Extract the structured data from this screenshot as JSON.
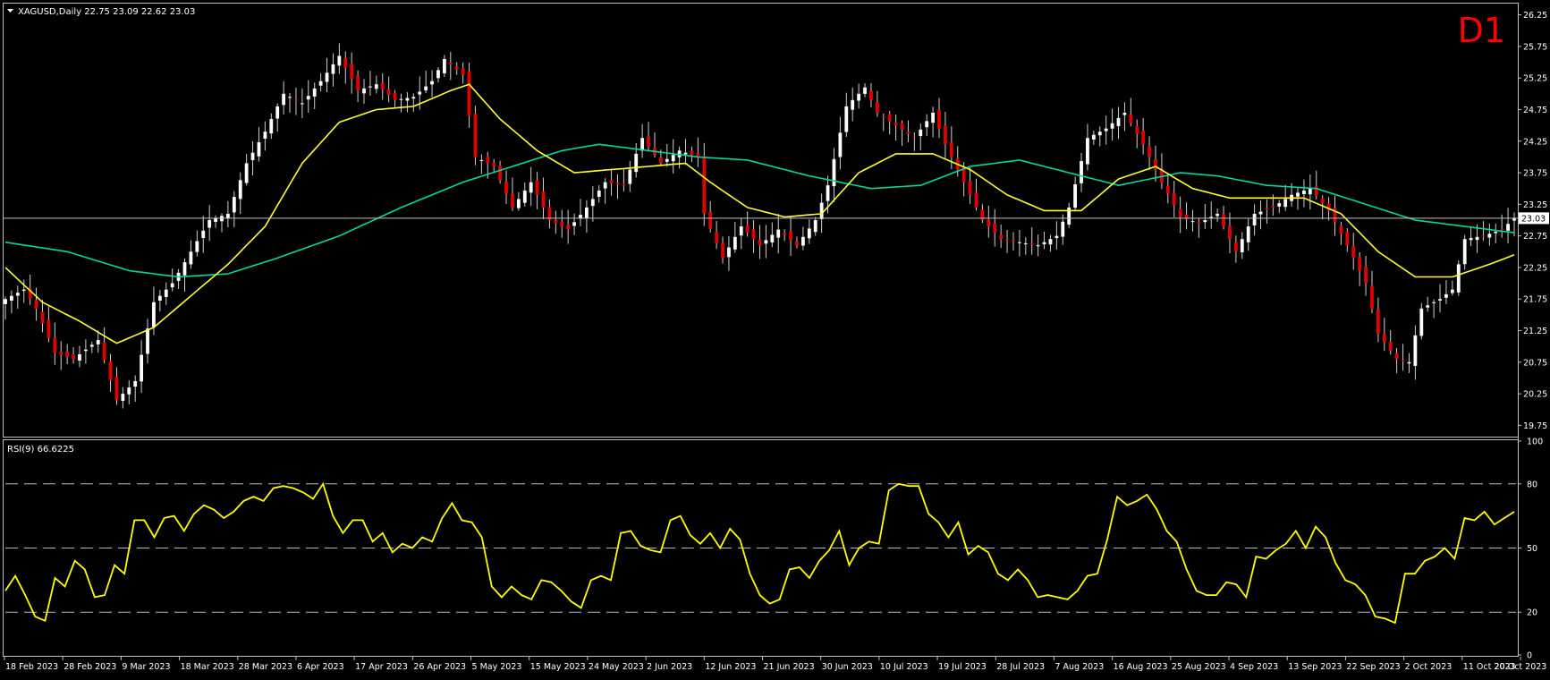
{
  "header": {
    "symbol_label": "XAGUSD,Daily  22.75 23.09 22.62 23.03",
    "timeframe_badge": "D1",
    "current_price_label": "23.03"
  },
  "rsi_panel": {
    "label": "RSI(9) 66.6225",
    "ticks": [
      "100",
      "80",
      "50",
      "20",
      "0"
    ]
  },
  "colors": {
    "background": "#000000",
    "bull_candle": "#ffffff",
    "bear_candle": "#e00000",
    "ma_fast": "#ffff33",
    "ma_slow": "#00d8a0",
    "rsi_line": "#ffff00",
    "frame": "#c0c0c0",
    "badge": "#ff0000"
  },
  "chart_data": [
    {
      "type": "candlestick",
      "title": "XAGUSD,Daily",
      "ylim": [
        19.6,
        26.4
      ],
      "y_ticks": [
        "26.25",
        "25.75",
        "25.25",
        "24.75",
        "24.25",
        "23.75",
        "23.25",
        "22.75",
        "22.25",
        "21.75",
        "21.25",
        "20.75",
        "20.25",
        "19.75"
      ],
      "y_tick_values": [
        26.25,
        25.75,
        25.25,
        24.75,
        24.25,
        23.75,
        23.25,
        22.75,
        22.25,
        21.75,
        21.25,
        20.75,
        20.25,
        19.75
      ],
      "x_labels": [
        "18 Feb 2023",
        "28 Feb 2023",
        "9 Mar 2023",
        "18 Mar 2023",
        "28 Mar 2023",
        "6 Apr 2023",
        "17 Apr 2023",
        "26 Apr 2023",
        "5 May 2023",
        "15 May 2023",
        "24 May 2023",
        "2 Jun 2023",
        "12 Jun 2023",
        "21 Jun 2023",
        "30 Jun 2023",
        "10 Jul 2023",
        "19 Jul 2023",
        "28 Jul 2023",
        "7 Aug 2023",
        "16 Aug 2023",
        "25 Aug 2023",
        "4 Sep 2023",
        "13 Sep 2023",
        "22 Sep 2023",
        "2 Oct 2023",
        "11 Oct 2023",
        "20 Oct 2023"
      ],
      "last_price": 23.03,
      "close_anchors": [
        [
          0,
          21.75
        ],
        [
          3,
          21.9
        ],
        [
          5,
          21.6
        ],
        [
          8,
          20.9
        ],
        [
          11,
          20.8
        ],
        [
          15,
          21.1
        ],
        [
          18,
          20.15
        ],
        [
          21,
          20.45
        ],
        [
          24,
          21.7
        ],
        [
          27,
          22.0
        ],
        [
          30,
          22.5
        ],
        [
          33,
          23.0
        ],
        [
          36,
          23.1
        ],
        [
          39,
          23.9
        ],
        [
          42,
          24.4
        ],
        [
          45,
          25.0
        ],
        [
          48,
          24.85
        ],
        [
          51,
          25.2
        ],
        [
          54,
          25.6
        ],
        [
          57,
          25.05
        ],
        [
          60,
          25.15
        ],
        [
          63,
          24.9
        ],
        [
          66,
          24.95
        ],
        [
          69,
          25.2
        ],
        [
          71,
          25.55
        ],
        [
          74,
          25.3
        ],
        [
          76,
          24.0
        ],
        [
          79,
          23.85
        ],
        [
          82,
          23.2
        ],
        [
          85,
          23.6
        ],
        [
          88,
          23.0
        ],
        [
          91,
          22.85
        ],
        [
          94,
          23.2
        ],
        [
          97,
          23.6
        ],
        [
          100,
          23.55
        ],
        [
          103,
          24.3
        ],
        [
          106,
          23.9
        ],
        [
          109,
          24.1
        ],
        [
          112,
          24.0
        ],
        [
          113,
          23.1
        ],
        [
          116,
          22.4
        ],
        [
          119,
          22.9
        ],
        [
          122,
          22.6
        ],
        [
          125,
          22.85
        ],
        [
          128,
          22.6
        ],
        [
          131,
          23.0
        ],
        [
          133,
          23.55
        ],
        [
          136,
          24.8
        ],
        [
          139,
          25.1
        ],
        [
          141,
          24.7
        ],
        [
          144,
          24.5
        ],
        [
          147,
          24.3
        ],
        [
          150,
          24.7
        ],
        [
          152,
          24.2
        ],
        [
          155,
          23.6
        ],
        [
          158,
          23.0
        ],
        [
          161,
          22.7
        ],
        [
          164,
          22.65
        ],
        [
          167,
          22.6
        ],
        [
          170,
          22.75
        ],
        [
          172,
          23.2
        ],
        [
          175,
          24.3
        ],
        [
          178,
          24.45
        ],
        [
          181,
          24.7
        ],
        [
          184,
          24.2
        ],
        [
          187,
          23.6
        ],
        [
          190,
          23.05
        ],
        [
          193,
          22.95
        ],
        [
          196,
          23.1
        ],
        [
          199,
          22.5
        ],
        [
          202,
          23.1
        ],
        [
          205,
          23.2
        ],
        [
          208,
          23.4
        ],
        [
          211,
          23.5
        ],
        [
          214,
          23.15
        ],
        [
          217,
          22.6
        ],
        [
          220,
          22.0
        ],
        [
          222,
          21.2
        ],
        [
          225,
          20.8
        ],
        [
          227,
          20.75
        ],
        [
          229,
          21.6
        ],
        [
          232,
          21.75
        ],
        [
          234,
          21.9
        ],
        [
          236,
          22.7
        ],
        [
          239,
          22.75
        ],
        [
          242,
          22.85
        ],
        [
          244,
          23.03
        ]
      ],
      "ma_fast_anchors": [
        [
          0,
          22.25
        ],
        [
          6,
          21.7
        ],
        [
          12,
          21.4
        ],
        [
          18,
          21.05
        ],
        [
          24,
          21.3
        ],
        [
          30,
          21.8
        ],
        [
          36,
          22.3
        ],
        [
          42,
          22.9
        ],
        [
          48,
          23.9
        ],
        [
          54,
          24.55
        ],
        [
          60,
          24.75
        ],
        [
          66,
          24.8
        ],
        [
          72,
          25.05
        ],
        [
          75,
          25.15
        ],
        [
          80,
          24.6
        ],
        [
          86,
          24.1
        ],
        [
          92,
          23.75
        ],
        [
          98,
          23.8
        ],
        [
          104,
          23.85
        ],
        [
          110,
          23.9
        ],
        [
          114,
          23.6
        ],
        [
          120,
          23.2
        ],
        [
          126,
          23.05
        ],
        [
          132,
          23.1
        ],
        [
          138,
          23.75
        ],
        [
          144,
          24.05
        ],
        [
          150,
          24.05
        ],
        [
          156,
          23.8
        ],
        [
          162,
          23.4
        ],
        [
          168,
          23.15
        ],
        [
          174,
          23.15
        ],
        [
          180,
          23.65
        ],
        [
          186,
          23.85
        ],
        [
          192,
          23.5
        ],
        [
          198,
          23.35
        ],
        [
          204,
          23.35
        ],
        [
          210,
          23.35
        ],
        [
          216,
          23.1
        ],
        [
          222,
          22.5
        ],
        [
          228,
          22.1
        ],
        [
          234,
          22.1
        ],
        [
          240,
          22.3
        ],
        [
          244,
          22.45
        ]
      ],
      "ma_slow_anchors": [
        [
          0,
          22.65
        ],
        [
          10,
          22.5
        ],
        [
          20,
          22.2
        ],
        [
          28,
          22.1
        ],
        [
          36,
          22.15
        ],
        [
          44,
          22.4
        ],
        [
          54,
          22.75
        ],
        [
          64,
          23.2
        ],
        [
          74,
          23.6
        ],
        [
          82,
          23.85
        ],
        [
          90,
          24.1
        ],
        [
          96,
          24.2
        ],
        [
          104,
          24.1
        ],
        [
          112,
          24.0
        ],
        [
          120,
          23.95
        ],
        [
          130,
          23.7
        ],
        [
          140,
          23.5
        ],
        [
          148,
          23.55
        ],
        [
          156,
          23.85
        ],
        [
          164,
          23.95
        ],
        [
          172,
          23.75
        ],
        [
          180,
          23.55
        ],
        [
          190,
          23.75
        ],
        [
          196,
          23.7
        ],
        [
          204,
          23.55
        ],
        [
          212,
          23.5
        ],
        [
          220,
          23.25
        ],
        [
          228,
          23.0
        ],
        [
          236,
          22.9
        ],
        [
          244,
          22.8
        ]
      ],
      "series": [
        {
          "name": "",
          "kind": "candles",
          "count": 245
        },
        {
          "name": "",
          "kind": "ma_fast"
        },
        {
          "name": "",
          "kind": "ma_slow"
        }
      ]
    },
    {
      "type": "line",
      "title": "RSI(9) 66.6225",
      "ylim": [
        0,
        100
      ],
      "levels": [
        80,
        50,
        20
      ],
      "y_ticks": [
        100,
        80,
        50,
        20,
        0
      ],
      "rsi_anchors": [
        [
          0,
          30
        ],
        [
          2,
          37
        ],
        [
          4,
          28
        ],
        [
          6,
          18
        ],
        [
          8,
          16
        ],
        [
          10,
          36
        ],
        [
          12,
          32
        ],
        [
          14,
          44
        ],
        [
          16,
          40
        ],
        [
          18,
          27
        ],
        [
          20,
          28
        ],
        [
          22,
          42
        ],
        [
          24,
          38
        ],
        [
          26,
          63
        ],
        [
          28,
          63
        ],
        [
          30,
          55
        ],
        [
          32,
          64
        ],
        [
          34,
          65
        ],
        [
          36,
          58
        ],
        [
          38,
          66
        ],
        [
          40,
          70
        ],
        [
          42,
          68
        ],
        [
          44,
          64
        ],
        [
          46,
          67
        ],
        [
          48,
          72
        ],
        [
          50,
          74
        ],
        [
          52,
          72
        ],
        [
          54,
          78
        ],
        [
          56,
          79
        ],
        [
          58,
          78
        ],
        [
          60,
          76
        ],
        [
          62,
          73
        ],
        [
          64,
          80
        ],
        [
          66,
          65
        ],
        [
          68,
          57
        ],
        [
          70,
          63
        ],
        [
          72,
          63
        ],
        [
          74,
          53
        ],
        [
          76,
          57
        ],
        [
          78,
          48
        ],
        [
          80,
          52
        ],
        [
          82,
          50
        ],
        [
          84,
          55
        ],
        [
          86,
          53
        ],
        [
          88,
          64
        ],
        [
          90,
          71
        ],
        [
          92,
          63
        ],
        [
          94,
          62
        ],
        [
          96,
          55
        ],
        [
          98,
          32
        ],
        [
          100,
          27
        ],
        [
          102,
          32
        ],
        [
          104,
          28
        ],
        [
          106,
          26
        ],
        [
          108,
          35
        ],
        [
          110,
          34
        ],
        [
          112,
          30
        ],
        [
          114,
          25
        ],
        [
          116,
          22
        ],
        [
          118,
          35
        ],
        [
          120,
          37
        ],
        [
          122,
          35
        ],
        [
          124,
          57
        ],
        [
          126,
          58
        ],
        [
          128,
          51
        ],
        [
          130,
          49
        ],
        [
          132,
          48
        ],
        [
          134,
          63
        ],
        [
          136,
          65
        ],
        [
          138,
          56
        ],
        [
          140,
          52
        ],
        [
          142,
          57
        ],
        [
          144,
          50
        ],
        [
          146,
          59
        ],
        [
          148,
          54
        ],
        [
          150,
          38
        ],
        [
          152,
          28
        ],
        [
          154,
          24
        ],
        [
          156,
          26
        ],
        [
          158,
          40
        ],
        [
          160,
          41
        ],
        [
          162,
          36
        ],
        [
          164,
          44
        ],
        [
          166,
          49
        ],
        [
          168,
          58
        ],
        [
          170,
          42
        ],
        [
          172,
          50
        ],
        [
          174,
          53
        ],
        [
          176,
          52
        ],
        [
          178,
          77
        ],
        [
          180,
          80
        ],
        [
          182,
          79
        ],
        [
          184,
          79
        ],
        [
          186,
          66
        ],
        [
          188,
          62
        ],
        [
          190,
          55
        ],
        [
          192,
          62
        ],
        [
          194,
          47
        ],
        [
          196,
          51
        ],
        [
          198,
          48
        ],
        [
          200,
          38
        ],
        [
          202,
          35
        ],
        [
          204,
          40
        ],
        [
          206,
          35
        ],
        [
          208,
          27
        ],
        [
          210,
          28
        ],
        [
          212,
          27
        ],
        [
          214,
          26
        ],
        [
          216,
          30
        ],
        [
          218,
          37
        ],
        [
          220,
          38
        ],
        [
          222,
          54
        ],
        [
          224,
          74
        ],
        [
          226,
          70
        ],
        [
          228,
          72
        ],
        [
          230,
          75
        ],
        [
          232,
          68
        ],
        [
          234,
          58
        ],
        [
          236,
          53
        ],
        [
          238,
          40
        ],
        [
          240,
          30
        ],
        [
          242,
          28
        ],
        [
          244,
          28
        ],
        [
          246,
          34
        ],
        [
          248,
          33
        ],
        [
          250,
          27
        ],
        [
          252,
          46
        ],
        [
          254,
          45
        ],
        [
          256,
          49
        ],
        [
          258,
          52
        ],
        [
          260,
          58
        ],
        [
          262,
          50
        ],
        [
          264,
          60
        ],
        [
          266,
          55
        ],
        [
          268,
          43
        ],
        [
          270,
          35
        ],
        [
          272,
          33
        ],
        [
          274,
          28
        ],
        [
          276,
          18
        ],
        [
          278,
          17
        ],
        [
          280,
          15
        ],
        [
          282,
          38
        ],
        [
          284,
          38
        ],
        [
          286,
          44
        ],
        [
          288,
          46
        ],
        [
          290,
          50
        ],
        [
          292,
          45
        ],
        [
          294,
          64
        ],
        [
          296,
          63
        ],
        [
          298,
          67
        ],
        [
          300,
          61
        ],
        [
          302,
          64
        ],
        [
          304,
          67
        ]
      ],
      "series": [
        {
          "name": "",
          "kind": "rsi"
        }
      ]
    }
  ]
}
